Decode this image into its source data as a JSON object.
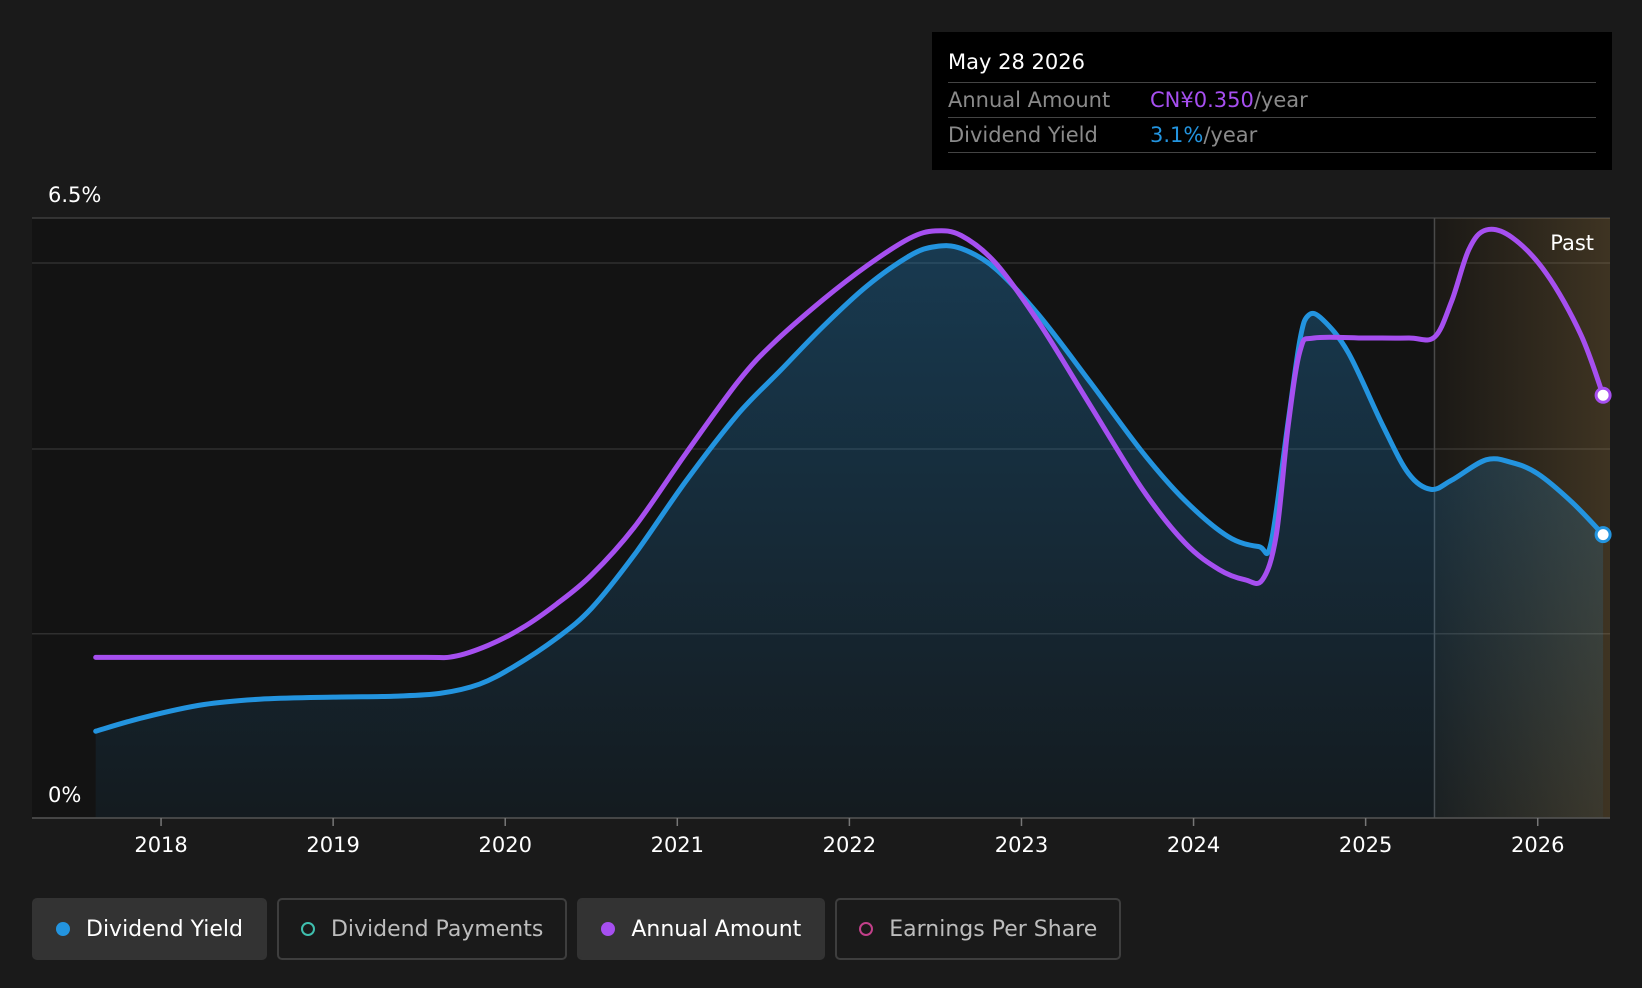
{
  "tooltip": {
    "date": "May 28 2026",
    "rows": [
      {
        "label": "Annual Amount",
        "value": "CN¥0.350",
        "unit": "/year"
      },
      {
        "label": "Dividend Yield",
        "value": "3.1%",
        "unit": "/year"
      }
    ]
  },
  "legend": [
    {
      "label": "Dividend Yield",
      "color": "#2394df",
      "active": true,
      "filled": true
    },
    {
      "label": "Dividend Payments",
      "color": "#3fbfae",
      "active": false,
      "filled": false
    },
    {
      "label": "Annual Amount",
      "color": "#a64ff0",
      "active": true,
      "filled": true
    },
    {
      "label": "Earnings Per Share",
      "color": "#c2408a",
      "active": false,
      "filled": false
    }
  ],
  "chart_data": {
    "type": "line",
    "y_top_label": "6.5%",
    "y_bottom_label": "0%",
    "ylim": [
      0,
      6.5
    ],
    "xlim": [
      2017.25,
      2026.42
    ],
    "x_ticks": [
      "2018",
      "2019",
      "2020",
      "2021",
      "2022",
      "2023",
      "2024",
      "2025",
      "2026"
    ],
    "x_tick_values": [
      2018,
      2019,
      2020,
      2021,
      2022,
      2023,
      2024,
      2025,
      2026
    ],
    "grid": true,
    "past_start": 2025.4,
    "past_label": "Past",
    "series": [
      {
        "name": "Dividend Yield",
        "color": "#2394df",
        "fill": true,
        "points": [
          [
            2017.62,
            0.94
          ],
          [
            2017.9,
            1.09
          ],
          [
            2018.25,
            1.23
          ],
          [
            2018.6,
            1.29
          ],
          [
            2019.0,
            1.31
          ],
          [
            2019.35,
            1.32
          ],
          [
            2019.62,
            1.35
          ],
          [
            2019.85,
            1.45
          ],
          [
            2020.05,
            1.64
          ],
          [
            2020.3,
            1.95
          ],
          [
            2020.5,
            2.27
          ],
          [
            2020.75,
            2.85
          ],
          [
            2021.05,
            3.65
          ],
          [
            2021.35,
            4.37
          ],
          [
            2021.6,
            4.85
          ],
          [
            2021.85,
            5.33
          ],
          [
            2022.1,
            5.76
          ],
          [
            2022.35,
            6.09
          ],
          [
            2022.5,
            6.19
          ],
          [
            2022.65,
            6.17
          ],
          [
            2022.85,
            5.95
          ],
          [
            2023.1,
            5.45
          ],
          [
            2023.4,
            4.72
          ],
          [
            2023.7,
            3.97
          ],
          [
            2023.95,
            3.44
          ],
          [
            2024.2,
            3.05
          ],
          [
            2024.38,
            2.94
          ],
          [
            2024.45,
            2.98
          ],
          [
            2024.55,
            4.3
          ],
          [
            2024.62,
            5.2
          ],
          [
            2024.67,
            5.45
          ],
          [
            2024.75,
            5.4
          ],
          [
            2024.9,
            5.04
          ],
          [
            2025.1,
            4.25
          ],
          [
            2025.25,
            3.73
          ],
          [
            2025.38,
            3.56
          ],
          [
            2025.5,
            3.66
          ],
          [
            2025.7,
            3.88
          ],
          [
            2025.85,
            3.85
          ],
          [
            2026.0,
            3.73
          ],
          [
            2026.2,
            3.42
          ],
          [
            2026.38,
            3.07
          ]
        ]
      },
      {
        "name": "Annual Amount",
        "color": "#a64ff0",
        "fill": false,
        "points": [
          [
            2017.62,
            1.74
          ],
          [
            2018.5,
            1.74
          ],
          [
            2019.5,
            1.74
          ],
          [
            2019.7,
            1.75
          ],
          [
            2019.9,
            1.87
          ],
          [
            2020.1,
            2.06
          ],
          [
            2020.3,
            2.32
          ],
          [
            2020.5,
            2.63
          ],
          [
            2020.75,
            3.15
          ],
          [
            2021.05,
            3.95
          ],
          [
            2021.35,
            4.72
          ],
          [
            2021.55,
            5.13
          ],
          [
            2021.85,
            5.62
          ],
          [
            2022.1,
            5.98
          ],
          [
            2022.35,
            6.28
          ],
          [
            2022.5,
            6.36
          ],
          [
            2022.65,
            6.31
          ],
          [
            2022.85,
            6.01
          ],
          [
            2023.1,
            5.37
          ],
          [
            2023.4,
            4.47
          ],
          [
            2023.7,
            3.57
          ],
          [
            2023.95,
            2.98
          ],
          [
            2024.15,
            2.69
          ],
          [
            2024.3,
            2.58
          ],
          [
            2024.4,
            2.58
          ],
          [
            2024.48,
            3.06
          ],
          [
            2024.55,
            4.25
          ],
          [
            2024.62,
            5.07
          ],
          [
            2024.7,
            5.2
          ],
          [
            2025.0,
            5.2
          ],
          [
            2025.25,
            5.2
          ],
          [
            2025.4,
            5.21
          ],
          [
            2025.5,
            5.6
          ],
          [
            2025.6,
            6.16
          ],
          [
            2025.7,
            6.37
          ],
          [
            2025.85,
            6.29
          ],
          [
            2026.05,
            5.9
          ],
          [
            2026.25,
            5.24
          ],
          [
            2026.38,
            4.58
          ]
        ]
      }
    ]
  }
}
